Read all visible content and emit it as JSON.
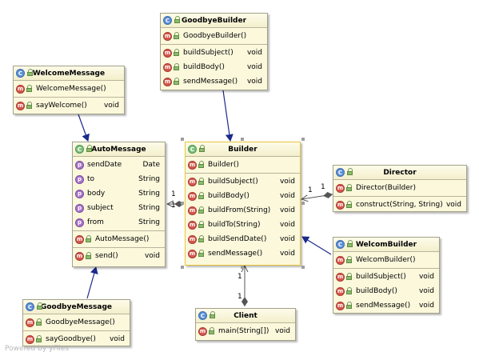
{
  "classes": {
    "goodbye_builder": {
      "name": "GoodbyeBuilder",
      "constructors": [
        {
          "label": "GoodbyeBuilder()",
          "type": ""
        }
      ],
      "methods": [
        {
          "label": "buildSubject()",
          "type": "void"
        },
        {
          "label": "buildBody()",
          "type": "void"
        },
        {
          "label": "sendMessage()",
          "type": "void"
        }
      ]
    },
    "welcome_message": {
      "name": "WelcomeMessage",
      "constructors": [
        {
          "label": "WelcomeMessage()",
          "type": ""
        }
      ],
      "methods": [
        {
          "label": "sayWelcome()",
          "type": "void"
        }
      ]
    },
    "auto_message": {
      "name": "AutoMessage",
      "fields": [
        {
          "label": "sendDate",
          "type": "Date"
        },
        {
          "label": "to",
          "type": "String"
        },
        {
          "label": "body",
          "type": "String"
        },
        {
          "label": "subject",
          "type": "String"
        },
        {
          "label": "from",
          "type": "String"
        }
      ],
      "constructors": [
        {
          "label": "AutoMessage()",
          "type": ""
        }
      ],
      "methods": [
        {
          "label": "send()",
          "type": "void"
        }
      ]
    },
    "builder": {
      "name": "Builder",
      "constructors": [
        {
          "label": "Builder()",
          "type": ""
        }
      ],
      "methods": [
        {
          "label": "buildSubject()",
          "type": "void"
        },
        {
          "label": "buildBody()",
          "type": "void"
        },
        {
          "label": "buildFrom(String)",
          "type": "void"
        },
        {
          "label": "buildTo(String)",
          "type": "void"
        },
        {
          "label": "buildSendDate()",
          "type": "void"
        },
        {
          "label": "sendMessage()",
          "type": "void"
        }
      ]
    },
    "director": {
      "name": "Director",
      "constructors": [
        {
          "label": "Director(Builder)",
          "type": ""
        }
      ],
      "methods": [
        {
          "label": "construct(String, String)",
          "type": "void"
        }
      ]
    },
    "welcom_builder": {
      "name": "WelcomBuilder",
      "constructors": [
        {
          "label": "WelcomBuilder()",
          "type": ""
        }
      ],
      "methods": [
        {
          "label": "buildSubject()",
          "type": "void"
        },
        {
          "label": "buildBody()",
          "type": "void"
        },
        {
          "label": "sendMessage()",
          "type": "void"
        }
      ]
    },
    "goodbye_message": {
      "name": "GoodbyeMessage",
      "constructors": [
        {
          "label": "GoodbyeMessage()",
          "type": ""
        }
      ],
      "methods": [
        {
          "label": "sayGoodbye()",
          "type": "void"
        }
      ]
    },
    "client": {
      "name": "Client",
      "methods": [
        {
          "label": "main(String[])",
          "type": "void"
        }
      ]
    }
  },
  "multiplicities": {
    "builder_automessage_near_auto": "1",
    "builder_automessage_near_builder": "1",
    "director_builder_near_builder": "1",
    "director_builder_near_director": "1",
    "client_builder_near_builder": "1",
    "client_builder_near_client": "1"
  },
  "icons": {
    "class": "class-icon",
    "abstract_class": "abstract-class-icon",
    "method": "method-icon",
    "field": "field-icon",
    "visibility": "public-lock-icon"
  },
  "colors": {
    "node_fill": "#fbf8dc",
    "node_border": "#a4a28a",
    "selected_border": "#e8c63a",
    "generalization_arrow": "#1a2a8c",
    "association_line": "#6b6b6b"
  },
  "watermark": "Powered by yFiles"
}
